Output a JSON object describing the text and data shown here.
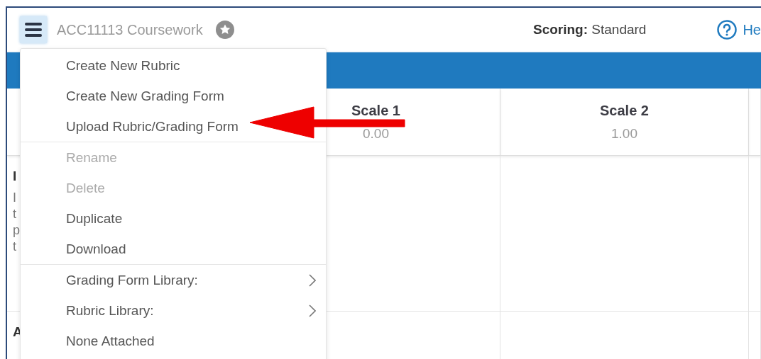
{
  "header": {
    "title": "ACC11113 Coursework",
    "scoring_label": "Scoring:",
    "scoring_value": "Standard",
    "help_link": "He"
  },
  "table": {
    "columns": [
      {
        "name": "Scale 1",
        "points": "0.00"
      },
      {
        "name": "Scale 2",
        "points": "1.00"
      }
    ],
    "rows": [
      {
        "title": "I",
        "description": [
          "I",
          "t",
          "p",
          "t"
        ]
      },
      {
        "title": "A",
        "description": []
      }
    ]
  },
  "menu": {
    "sections": [
      [
        {
          "label": "Create New Rubric",
          "kind": "action",
          "disabled": false
        },
        {
          "label": "Create New Grading Form",
          "kind": "action",
          "disabled": false
        },
        {
          "label": "Upload Rubric/Grading Form",
          "kind": "action",
          "disabled": false
        }
      ],
      [
        {
          "label": "Rename",
          "kind": "action",
          "disabled": true
        },
        {
          "label": "Delete",
          "kind": "action",
          "disabled": true
        },
        {
          "label": "Duplicate",
          "kind": "action",
          "disabled": false
        },
        {
          "label": "Download",
          "kind": "action",
          "disabled": false
        }
      ],
      [
        {
          "label": "Grading Form Library:",
          "kind": "submenu",
          "disabled": false
        },
        {
          "label": "Rubric Library:",
          "kind": "submenu",
          "disabled": false
        },
        {
          "label": "None Attached",
          "kind": "action",
          "disabled": false
        }
      ]
    ]
  }
}
